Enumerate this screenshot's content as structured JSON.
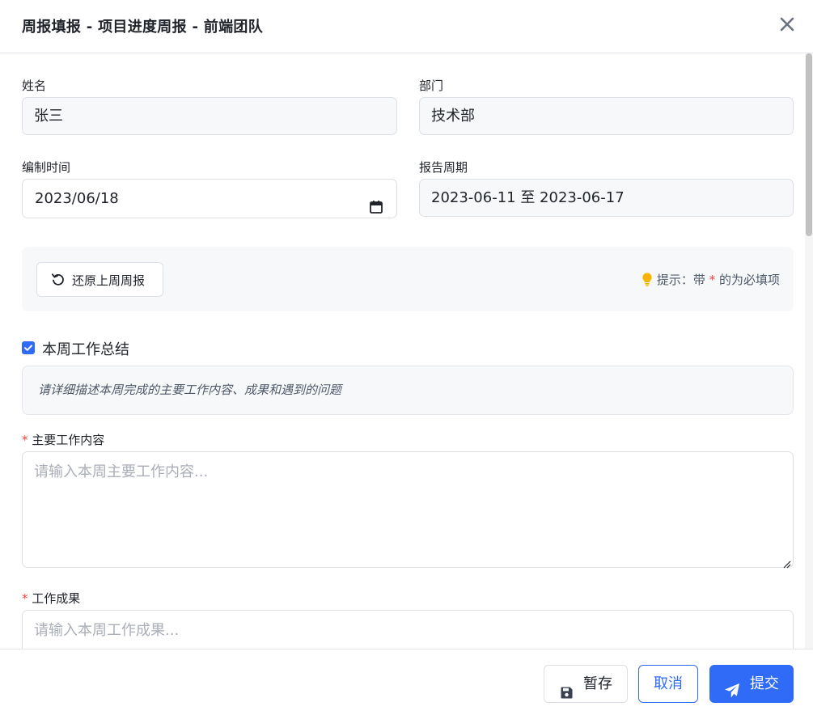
{
  "header": {
    "title": "周报填报 - 项目进度周报 - 前端团队",
    "close_icon": "close-icon"
  },
  "form": {
    "name": {
      "label": "姓名",
      "value": "张三"
    },
    "department": {
      "label": "部门",
      "value": "技术部"
    },
    "compile_date": {
      "label": "编制时间",
      "value": "2023/06/18",
      "icon": "calendar-icon"
    },
    "report_period": {
      "label": "报告周期",
      "value": "2023-06-11 至 2023-06-17"
    }
  },
  "toolbar": {
    "restore_label": "还原上周周报",
    "restore_icon": "undo-icon",
    "hint_prefix": "提示：带",
    "hint_star": "*",
    "hint_suffix": "的为必填项",
    "hint_icon": "lightbulb-icon"
  },
  "section": {
    "checkbox_checked": true,
    "title": "本周工作总结",
    "description": "请详细描述本周完成的主要工作内容、成果和遇到的问题"
  },
  "fields": {
    "main_work": {
      "required_mark": "*",
      "label": "主要工作内容",
      "placeholder": "请输入本周主要工作内容..."
    },
    "results": {
      "required_mark": "*",
      "label": "工作成果",
      "placeholder": "请输入本周工作成果..."
    }
  },
  "footer": {
    "save_label": "暂存",
    "save_icon": "floppy-disk-icon",
    "cancel_label": "取消",
    "submit_label": "提交",
    "submit_icon": "paper-plane-icon"
  },
  "colors": {
    "primary": "#2f6bf6",
    "required": "#f53f3f",
    "hint_bulb": "#f7b500"
  }
}
